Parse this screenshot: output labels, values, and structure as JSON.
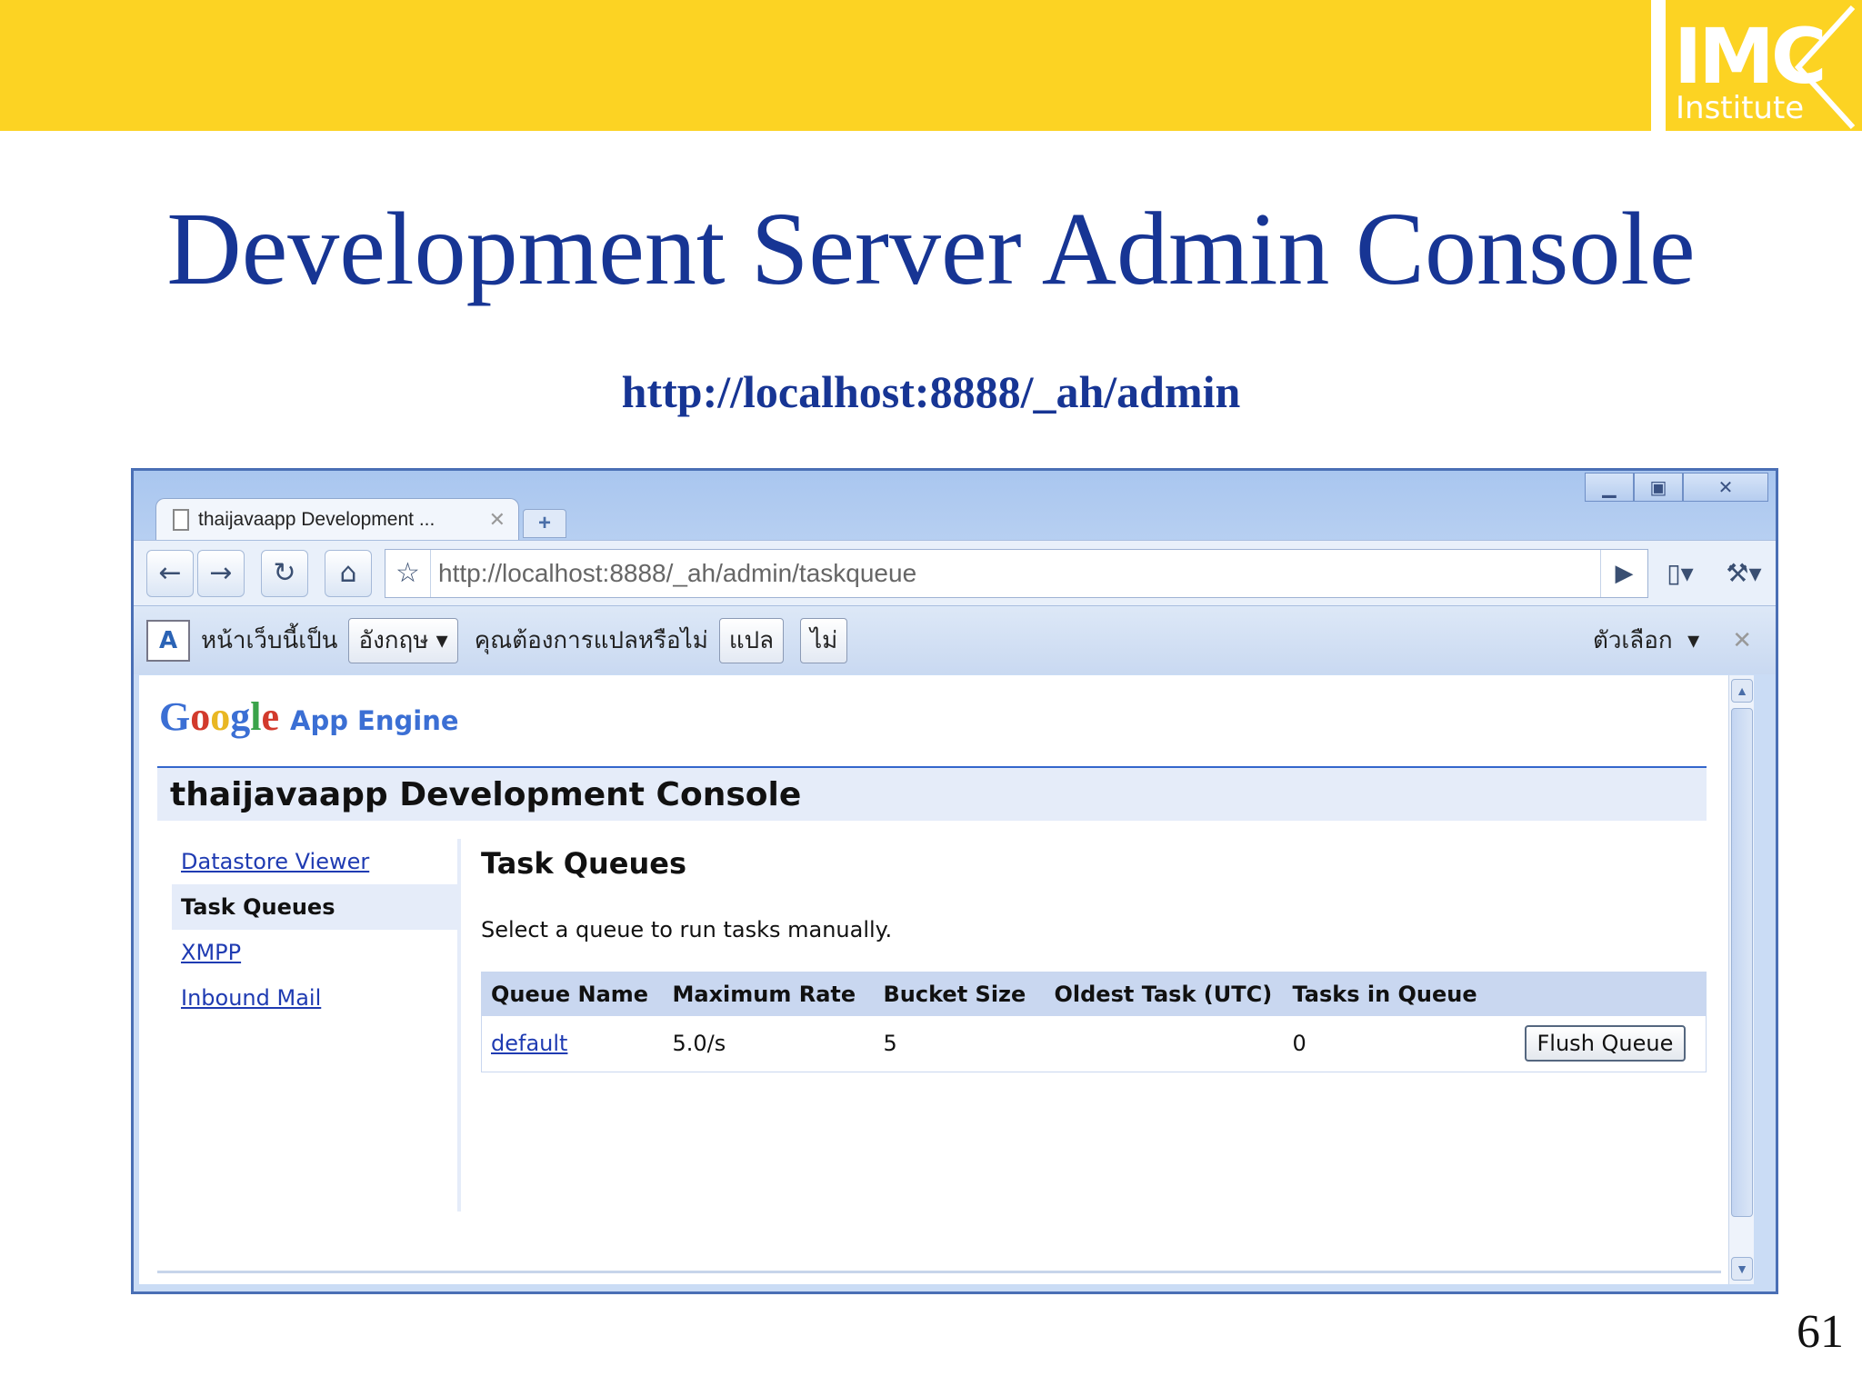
{
  "slide": {
    "title": "Development Server Admin Console",
    "subtitle_url": "http://localhost:8888/_ah/admin",
    "page_number": "61",
    "logo": {
      "main": "IMC",
      "sub": "Institute"
    },
    "band_color": "#FCD323",
    "title_color": "#173594"
  },
  "browser": {
    "tab_title": "thaijavaapp Development ...",
    "url": "http://localhost:8888/_ah/admin/taskqueue",
    "infobar": {
      "text_1": "หน้าเว็บนี้เป็น",
      "language_select": "อังกฤษ",
      "text_2": "คุณต้องการแปลหรือไม่",
      "translate_button": "แปล",
      "no_button": "ไม่",
      "options": "ตัวเลือก"
    }
  },
  "console": {
    "logo_google": "Google",
    "logo_app_engine": "App Engine",
    "title": "thaijavaapp Development Console",
    "nav": [
      {
        "label": "Datastore Viewer"
      },
      {
        "label": "Task Queues"
      },
      {
        "label": "XMPP"
      },
      {
        "label": "Inbound Mail"
      }
    ],
    "heading": "Task Queues",
    "description": "Select a queue to run tasks manually.",
    "table": {
      "headers": [
        "Queue Name",
        "Maximum Rate",
        "Bucket Size",
        "Oldest Task (UTC)",
        "Tasks in Queue"
      ],
      "rows": [
        {
          "name": "default",
          "rate": "5.0/s",
          "bucket": "5",
          "oldest": "",
          "tasks": "0",
          "action": "Flush Queue"
        }
      ]
    }
  }
}
